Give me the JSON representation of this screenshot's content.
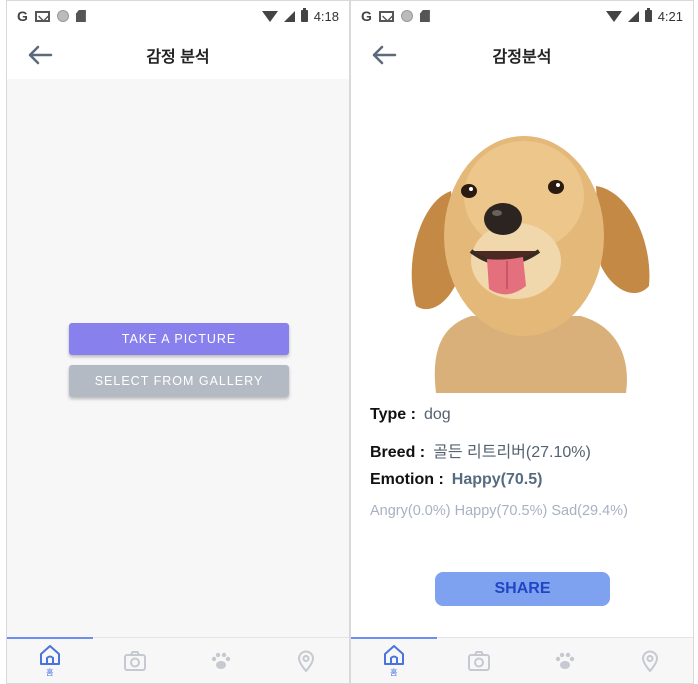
{
  "screens": [
    {
      "status": {
        "time": "4:18"
      },
      "header": {
        "title": "감정 분석"
      },
      "buttons": {
        "take_picture": "TAKE A PICTURE",
        "gallery": "SELECT FROM GALLERY"
      },
      "nav": {
        "home_label": "홈"
      }
    },
    {
      "status": {
        "time": "4:21"
      },
      "header": {
        "title": "감정분석"
      },
      "result": {
        "type_label": "Type :",
        "type_value": "dog",
        "breed_label": "Breed :",
        "breed_value": "골든 리트리버(27.10%)",
        "emotion_label": "Emotion :",
        "emotion_value": "Happy(70.5)",
        "emotion_detail": "Angry(0.0%) Happy(70.5%) Sad(29.4%)"
      },
      "share_label": "SHARE",
      "nav": {
        "home_label": "홈"
      }
    }
  ],
  "icons": {
    "status": [
      "google-icon",
      "gmail-icon",
      "circle-icon",
      "sd-card-icon",
      "wifi-icon",
      "signal-icon",
      "battery-icon"
    ],
    "nav": [
      "home-icon",
      "camera-icon",
      "paw-icon",
      "location-icon"
    ]
  },
  "colors": {
    "primary_button": "#8880ec",
    "secondary_button": "#b4bac4",
    "share_button": "#7ea2ef",
    "nav_active": "#4a73e0"
  }
}
